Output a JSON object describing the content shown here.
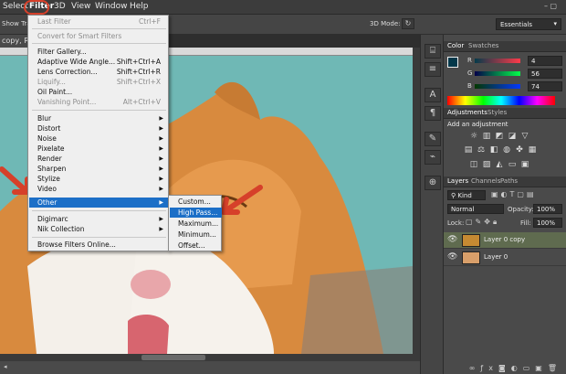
{
  "menubar": {
    "items": [
      "Select",
      "Filter",
      "3D",
      "View",
      "Window",
      "Help"
    ],
    "active": "Filter"
  },
  "options_bar": {
    "show_transform": "Show Tran",
    "mode_3d": "3D Mode:",
    "workspace": "Essentials"
  },
  "document": {
    "tab_title": "copy, RG..."
  },
  "filter_menu": {
    "items": [
      {
        "label": "Last Filter",
        "shortcut": "Ctrl+F",
        "disabled": true
      },
      {
        "label": "Convert for Smart Filters",
        "shortcut": "",
        "disabled": true
      },
      {
        "label": "Filter Gallery...",
        "shortcut": "",
        "disabled": false
      },
      {
        "label": "Adaptive Wide Angle...",
        "shortcut": "Shift+Ctrl+A",
        "disabled": false
      },
      {
        "label": "Lens Correction...",
        "shortcut": "Shift+Ctrl+R",
        "disabled": false
      },
      {
        "label": "Liquify...",
        "shortcut": "Shift+Ctrl+X",
        "disabled": true
      },
      {
        "label": "Oil Paint...",
        "shortcut": "",
        "disabled": false
      },
      {
        "label": "Vanishing Point...",
        "shortcut": "Alt+Ctrl+V",
        "disabled": true
      },
      {
        "label": "Blur",
        "submenu": true
      },
      {
        "label": "Distort",
        "submenu": true
      },
      {
        "label": "Noise",
        "submenu": true
      },
      {
        "label": "Pixelate",
        "submenu": true
      },
      {
        "label": "Render",
        "submenu": true
      },
      {
        "label": "Sharpen",
        "submenu": true
      },
      {
        "label": "Stylize",
        "submenu": true
      },
      {
        "label": "Video",
        "submenu": true
      },
      {
        "label": "Other",
        "submenu": true,
        "highlighted": true
      },
      {
        "label": "Digimarc",
        "submenu": true
      },
      {
        "label": "Nik Collection",
        "submenu": true
      },
      {
        "label": "Browse Filters Online...",
        "submenu": false
      }
    ]
  },
  "other_submenu": {
    "items": [
      "Custom...",
      "High Pass...",
      "Maximum...",
      "Minimum...",
      "Offset..."
    ],
    "highlighted": "High Pass..."
  },
  "color_panel": {
    "tabs": [
      "Color",
      "Swatches"
    ],
    "r_label": "R",
    "g_label": "G",
    "b_label": "B",
    "r_value": "4",
    "g_value": "56",
    "b_value": "74",
    "foreground_color": "#04384a"
  },
  "adjustments_panel": {
    "tabs": [
      "Adjustments",
      "Styles"
    ],
    "heading": "Add an adjustment"
  },
  "layers_panel": {
    "tabs": [
      "Layers",
      "Channels",
      "Paths"
    ],
    "kind_filter": "Kind",
    "blend_mode": "Normal",
    "opacity_label": "Opacity:",
    "opacity_value": "100%",
    "lock_label": "Lock:",
    "fill_label": "Fill:",
    "fill_value": "100%",
    "layers": [
      {
        "name": "Layer 0 copy",
        "selected": true
      },
      {
        "name": "Layer 0",
        "selected": false
      }
    ]
  },
  "colors": {
    "highlight": "#1c6fc7",
    "annotation_red": "#d6402a",
    "canvas_bg": "#6cb6b3"
  }
}
